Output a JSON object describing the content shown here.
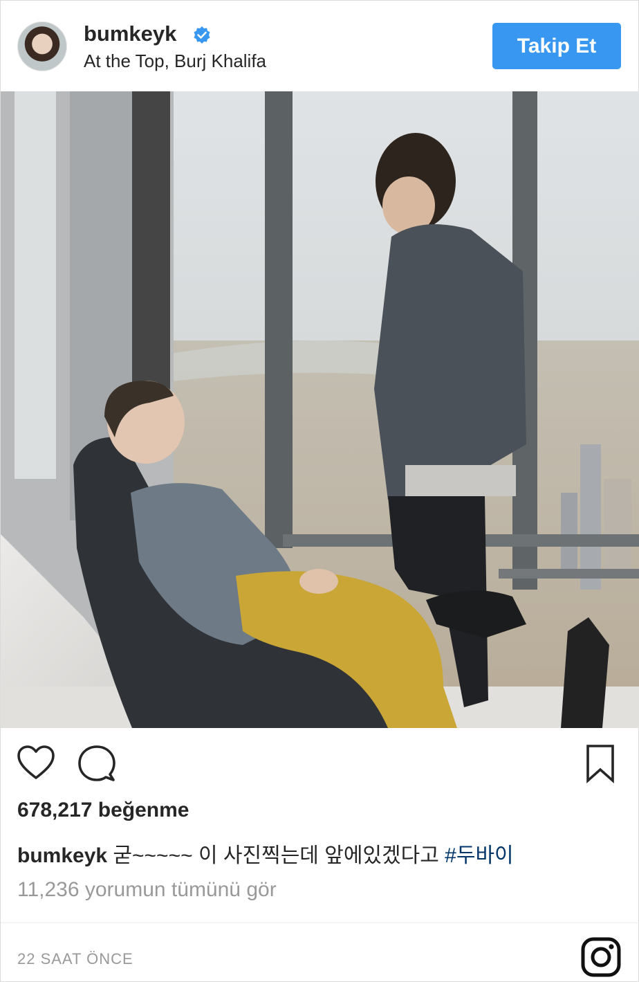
{
  "header": {
    "username": "bumkeyk",
    "verified_icon": "verified-badge-icon",
    "location": "At the Top, Burj Khalifa",
    "follow_label": "Takip Et"
  },
  "post": {
    "likes_text": "678,217 beğenme",
    "caption": {
      "user": "bumkeyk",
      "text": "굳~~~~~ 이 사진찍는데 앞에있겠다고",
      "hashtag": "#두바이"
    },
    "view_comments": "11,236 yorumun tümünü gör",
    "timestamp": "22 SAAT ÖNCE"
  },
  "icons": {
    "like": "heart-icon",
    "comment": "comment-icon",
    "save": "bookmark-icon",
    "brand": "instagram-icon"
  },
  "colors": {
    "accent": "#3897f0",
    "hashtag": "#003569",
    "muted": "#999999",
    "text": "#262626"
  }
}
